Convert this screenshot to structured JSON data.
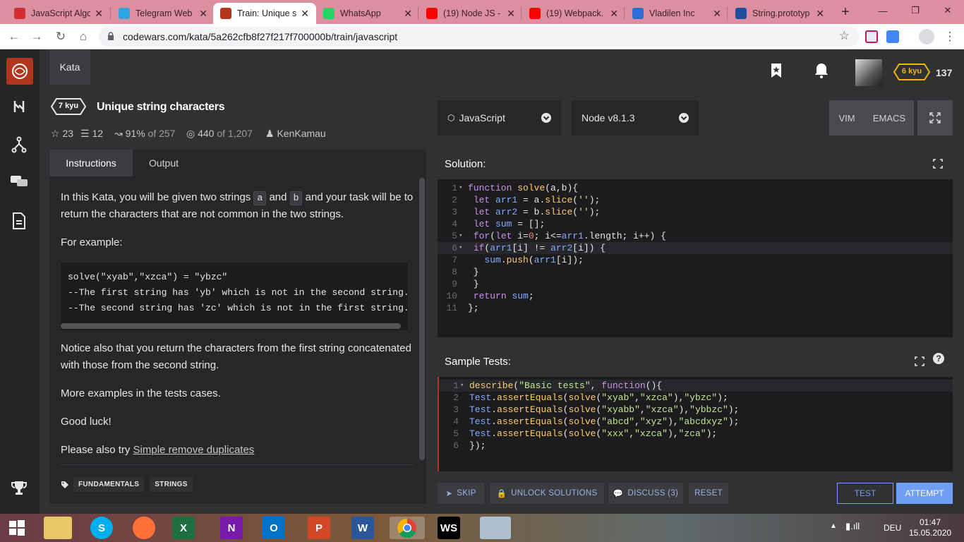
{
  "browser": {
    "tabs": [
      {
        "title": "JavaScript Algo",
        "icon_color": "#d12f2f",
        "glyph": ""
      },
      {
        "title": "Telegram Web",
        "icon_color": "#2ca5e0",
        "glyph": ""
      },
      {
        "title": "Train: Unique st",
        "icon_color": "#b1361e",
        "glyph": ""
      },
      {
        "title": "WhatsApp",
        "icon_color": "#25d366",
        "glyph": ""
      },
      {
        "title": "(19) Node JS - ",
        "icon_color": "#ff0000",
        "glyph": ""
      },
      {
        "title": "(19) Webpack.",
        "icon_color": "#ff0000",
        "glyph": ""
      },
      {
        "title": "Vladilen Inc",
        "icon_color": "#2d6fd2",
        "glyph": ""
      },
      {
        "title": "String.prototyp",
        "icon_color": "#1b4f9c",
        "glyph": ""
      }
    ],
    "url": "codewars.com/kata/5a262cfb8f27f217f700000b/train/javascript"
  },
  "nav": {
    "kata_label": "Kata",
    "honor": "137",
    "rank": "6 kyu"
  },
  "kata": {
    "rank": "7 kyu",
    "title": "Unique string characters",
    "stars": "23",
    "collections": "12",
    "satisfaction": "91%",
    "satisfaction_of": "of 257",
    "completed": "440",
    "completed_of": "of 1,207",
    "author": "KenKamau"
  },
  "editor_settings": {
    "language": "JavaScript",
    "version": "Node v8.1.3",
    "vim": "VIM",
    "emacs": "EMACS"
  },
  "instructions": {
    "tab_instructions": "Instructions",
    "tab_output": "Output",
    "p1_a": "In this Kata, you will be given two strings ",
    "p1_code_a": "a",
    "p1_b": " and ",
    "p1_code_b": "b",
    "p1_c": " and your task will be to return the characters that are not common in the two strings.",
    "p2": "For example:",
    "example_code": "solve(\"xyab\",\"xzca\") = \"ybzc\"\n--The first string has 'yb' which is not in the second string.\n--The second string has 'zc' which is not in the first string.",
    "p3": "Notice also that you return the characters from the first string concatenated with those from the second string.",
    "p4": "More examples in the tests cases.",
    "p5": "Good luck!",
    "p6_prefix": "Please also try ",
    "p6_link": "Simple remove duplicates",
    "tags": [
      "FUNDAMENTALS",
      "STRINGS"
    ]
  },
  "solution": {
    "label": "Solution:",
    "lines": [
      "function solve(a,b){",
      " let arr1 = a.slice('');",
      " let arr2 = b.slice('');",
      " let sum = [];",
      " for(let i=0; i<=arr1.length; i++) {",
      " if(arr1[i] != arr2[i]) {",
      "   sum.push(arr1[i]);",
      " }",
      " }",
      " return sum;",
      "};"
    ]
  },
  "tests": {
    "label": "Sample Tests:",
    "lines": [
      "describe(\"Basic tests\", function(){",
      "Test.assertEquals(solve(\"xyab\",\"xzca\"),\"ybzc\");",
      "Test.assertEquals(solve(\"xyabb\",\"xzca\"),\"ybbzc\");",
      "Test.assertEquals(solve(\"abcd\",\"xyz\"),\"abcdxyz\");",
      "Test.assertEquals(solve(\"xxx\",\"xzca\"),\"zca\");",
      "});"
    ]
  },
  "actions": {
    "skip": "SKIP",
    "unlock": "UNLOCK SOLUTIONS",
    "discuss": "DISCUSS (3)",
    "reset": "RESET",
    "test": "TEST",
    "attempt": "ATTEMPT"
  },
  "taskbar": {
    "time": "01:47",
    "date": "15.05.2020",
    "lang": "DEU"
  }
}
